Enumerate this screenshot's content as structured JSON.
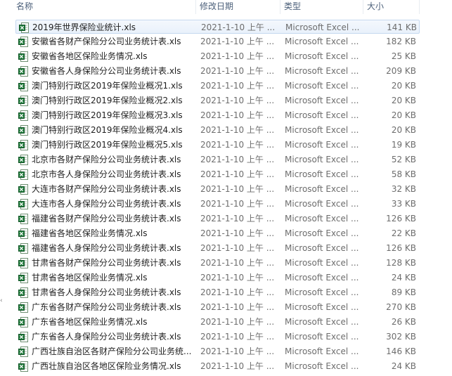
{
  "columns": {
    "name": "名称",
    "date": "修改日期",
    "type": "类型",
    "size": "大小"
  },
  "icon": "excel-file-icon",
  "colors": {
    "excel_green": "#1f7a3a",
    "selection": "#e9f1fb"
  },
  "files": [
    {
      "name": "2019年世界保险业统计.xls",
      "date": "2021-1-10 上午 ...",
      "type": "Microsoft Excel ...",
      "size": "141 KB",
      "selected": true
    },
    {
      "name": "安徽省各财产保险分公司业务统计表.xls",
      "date": "2021-1-10 上午 ...",
      "type": "Microsoft Excel ...",
      "size": "182 KB"
    },
    {
      "name": "安徽省各地区保险业务情况.xls",
      "date": "2021-1-10 上午 ...",
      "type": "Microsoft Excel ...",
      "size": "25 KB"
    },
    {
      "name": "安徽省各人身保险分公司业务统计表.xls",
      "date": "2021-1-10 上午 ...",
      "type": "Microsoft Excel ...",
      "size": "209 KB"
    },
    {
      "name": "澳门特别行政区2019年保险业概况1.xls",
      "date": "2021-1-10 上午 ...",
      "type": "Microsoft Excel ...",
      "size": "20 KB"
    },
    {
      "name": "澳门特别行政区2019年保险业概况2.xls",
      "date": "2021-1-10 上午 ...",
      "type": "Microsoft Excel ...",
      "size": "20 KB"
    },
    {
      "name": "澳门特别行政区2019年保险业概况3.xls",
      "date": "2021-1-10 上午 ...",
      "type": "Microsoft Excel ...",
      "size": "20 KB"
    },
    {
      "name": "澳门特别行政区2019年保险业概况4.xls",
      "date": "2021-1-10 上午 ...",
      "type": "Microsoft Excel ...",
      "size": "20 KB"
    },
    {
      "name": "澳门特别行政区2019年保险业概况5.xls",
      "date": "2021-1-10 上午 ...",
      "type": "Microsoft Excel ...",
      "size": "19 KB"
    },
    {
      "name": "北京市各财产保险分公司业务统计表.xls",
      "date": "2021-1-10 上午 ...",
      "type": "Microsoft Excel ...",
      "size": "52 KB"
    },
    {
      "name": "北京市各人身保险分公司业务统计表.xls",
      "date": "2021-1-10 上午 ...",
      "type": "Microsoft Excel ...",
      "size": "58 KB"
    },
    {
      "name": "大连市各财产保险分公司业务统计表.xls",
      "date": "2021-1-10 上午 ...",
      "type": "Microsoft Excel ...",
      "size": "32 KB"
    },
    {
      "name": "大连市各人身保险分公司业务统计表.xls",
      "date": "2021-1-10 上午 ...",
      "type": "Microsoft Excel ...",
      "size": "33 KB"
    },
    {
      "name": "福建省各财产保险分公司业务统计表.xls",
      "date": "2021-1-10 上午 ...",
      "type": "Microsoft Excel ...",
      "size": "126 KB"
    },
    {
      "name": "福建省各地区保险业务情况.xls",
      "date": "2021-1-10 上午 ...",
      "type": "Microsoft Excel ...",
      "size": "22 KB"
    },
    {
      "name": "福建省各人身保险分公司业务统计表.xls",
      "date": "2021-1-10 上午 ...",
      "type": "Microsoft Excel ...",
      "size": "126 KB"
    },
    {
      "name": "甘肃省各财产保险分公司业务统计表.xls",
      "date": "2021-1-10 上午 ...",
      "type": "Microsoft Excel ...",
      "size": "128 KB"
    },
    {
      "name": "甘肃省各地区保险业务情况.xls",
      "date": "2021-1-10 上午 ...",
      "type": "Microsoft Excel ...",
      "size": "24 KB"
    },
    {
      "name": "甘肃省各人身保险分公司业务统计表.xls",
      "date": "2021-1-10 上午 ...",
      "type": "Microsoft Excel ...",
      "size": "89 KB"
    },
    {
      "name": "广东省各财产保险分公司业务统计表.xls",
      "date": "2021-1-10 上午 ...",
      "type": "Microsoft Excel ...",
      "size": "270 KB"
    },
    {
      "name": "广东省各地区保险业务情况.xls",
      "date": "2021-1-10 上午 ...",
      "type": "Microsoft Excel ...",
      "size": "26 KB"
    },
    {
      "name": "广东省各人身保险分公司业务统计表.xls",
      "date": "2021-1-10 上午 ...",
      "type": "Microsoft Excel ...",
      "size": "302 KB"
    },
    {
      "name": "广西壮族自治区各财产保险分公司业务统...",
      "date": "2021-1-10 上午 ...",
      "type": "Microsoft Excel ...",
      "size": "146 KB"
    },
    {
      "name": "广西壮族自治区各地区保险业务情况.xls",
      "date": "2021-1-10 上午 ...",
      "type": "Microsoft Excel ...",
      "size": "24 KB"
    }
  ]
}
